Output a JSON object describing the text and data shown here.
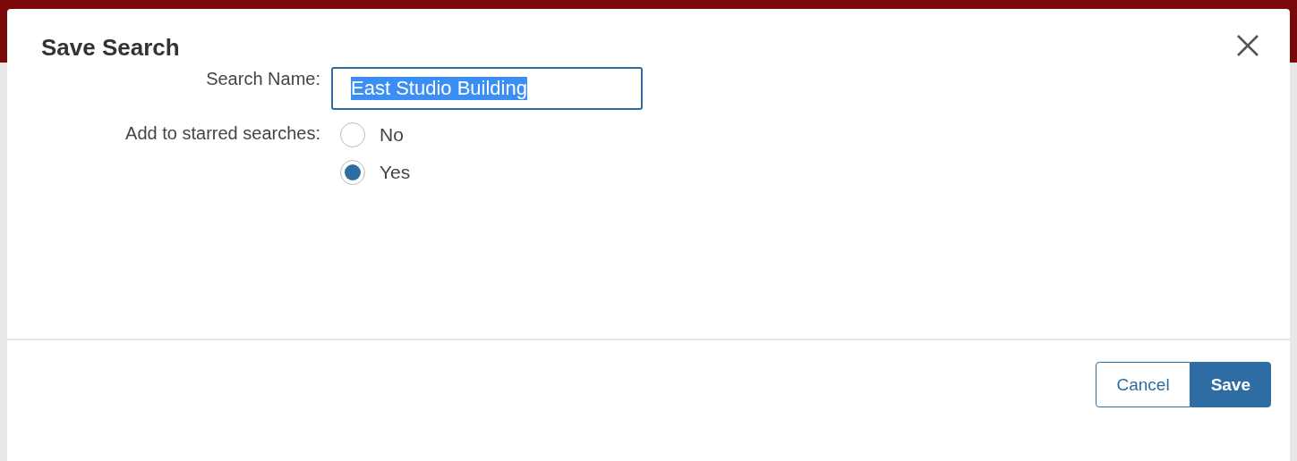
{
  "dialog": {
    "title": "Save Search"
  },
  "fields": [
    {
      "kind": "text",
      "label": "Search Name:",
      "value": "East Studio Building",
      "text_selected": true
    },
    {
      "kind": "radio",
      "label": "Add to starred searches:",
      "options": [
        {
          "label": "No",
          "selected": false
        },
        {
          "label": "Yes",
          "selected": true
        }
      ]
    }
  ],
  "buttons": [
    {
      "label": "Cancel",
      "kind": "secondary"
    },
    {
      "label": "Save",
      "kind": "primary"
    }
  ]
}
